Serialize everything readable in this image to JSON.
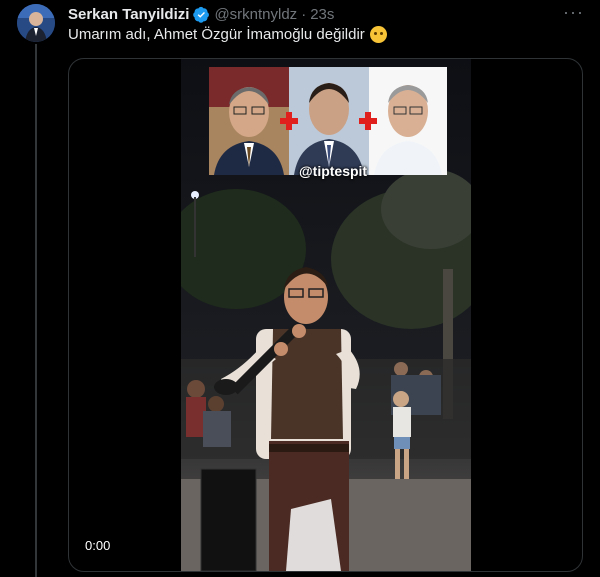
{
  "tweet": {
    "author_name": "Serkan Tanyildizi",
    "handle": "@srkntnyldz",
    "separator": "·",
    "time": "23s",
    "more_label": "···",
    "text": "Umarım adı, Ahmet Özgür İmamoğlu değildir",
    "emoji": "rolling-eyes-emoji"
  },
  "media": {
    "watermark": "@tiptespit",
    "video_time": "0:00"
  },
  "colors": {
    "background": "#000000",
    "text": "#e7e9ea",
    "muted": "#71767b",
    "verified": "#1d9bf0",
    "border": "#2f3336"
  }
}
